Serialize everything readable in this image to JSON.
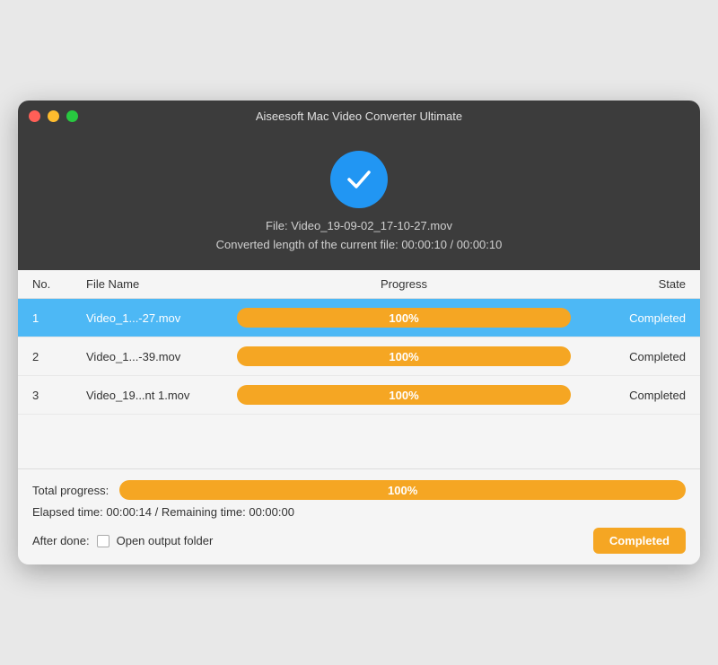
{
  "window": {
    "title": "Aiseesoft Mac Video Converter Ultimate"
  },
  "header": {
    "file_line1": "File: Video_19-09-02_17-10-27.mov",
    "file_line2": "Converted length of the current file: 00:00:10 / 00:00:10",
    "checkmark_icon": "checkmark-icon"
  },
  "table": {
    "columns": {
      "no": "No.",
      "filename": "File Name",
      "progress": "Progress",
      "state": "State"
    },
    "rows": [
      {
        "no": "1",
        "filename": "Video_1...-27.mov",
        "progress": "100%",
        "progress_pct": 100,
        "state": "Completed",
        "selected": true
      },
      {
        "no": "2",
        "filename": "Video_1...-39.mov",
        "progress": "100%",
        "progress_pct": 100,
        "state": "Completed",
        "selected": false
      },
      {
        "no": "3",
        "filename": "Video_19...nt 1.mov",
        "progress": "100%",
        "progress_pct": 100,
        "state": "Completed",
        "selected": false
      }
    ]
  },
  "footer": {
    "total_label": "Total progress:",
    "total_pct": "100%",
    "elapsed": "Elapsed time: 00:00:14 / Remaining time: 00:00:00",
    "after_done_label": "After done:",
    "open_output_folder_label": "Open output folder",
    "completed_btn_label": "Completed"
  },
  "colors": {
    "orange": "#f5a623",
    "blue_selected": "#4db8f5",
    "dark_bg": "#3c3c3c",
    "check_blue": "#2196f3"
  }
}
